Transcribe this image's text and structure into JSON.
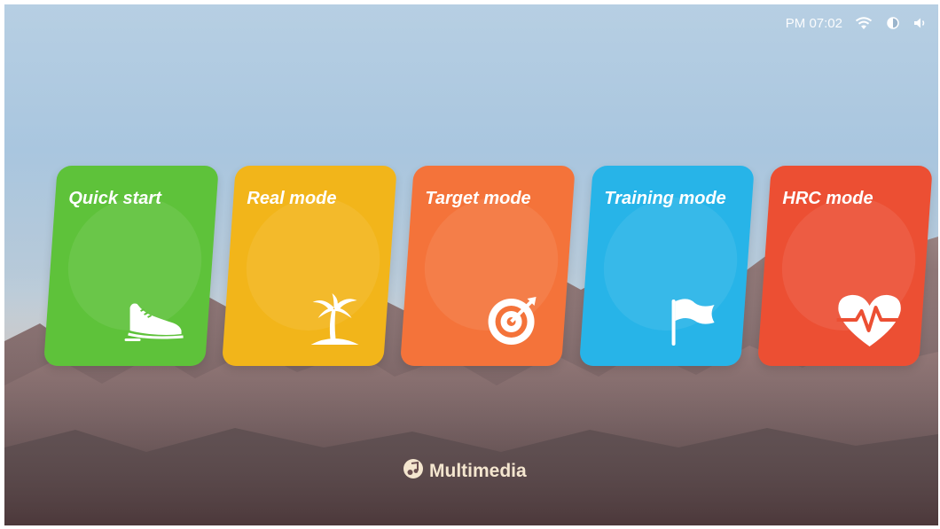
{
  "status_bar": {
    "time": "PM 07:02",
    "icons": [
      "wifi-icon",
      "brightness-icon",
      "volume-icon"
    ]
  },
  "cards": [
    {
      "label": "Quick start",
      "icon": "shoe-icon",
      "color": "#5ec23a"
    },
    {
      "label": "Real mode",
      "icon": "palm-tree-icon",
      "color": "#f2b51a"
    },
    {
      "label": "Target mode",
      "icon": "target-icon",
      "color": "#f4733a"
    },
    {
      "label": "Training mode",
      "icon": "flag-icon",
      "color": "#27b4e8"
    },
    {
      "label": "HRC mode",
      "icon": "heart-rate-icon",
      "color": "#ec4f33"
    }
  ],
  "multimedia": {
    "label": "Multimedia",
    "icon": "music-note-icon"
  }
}
